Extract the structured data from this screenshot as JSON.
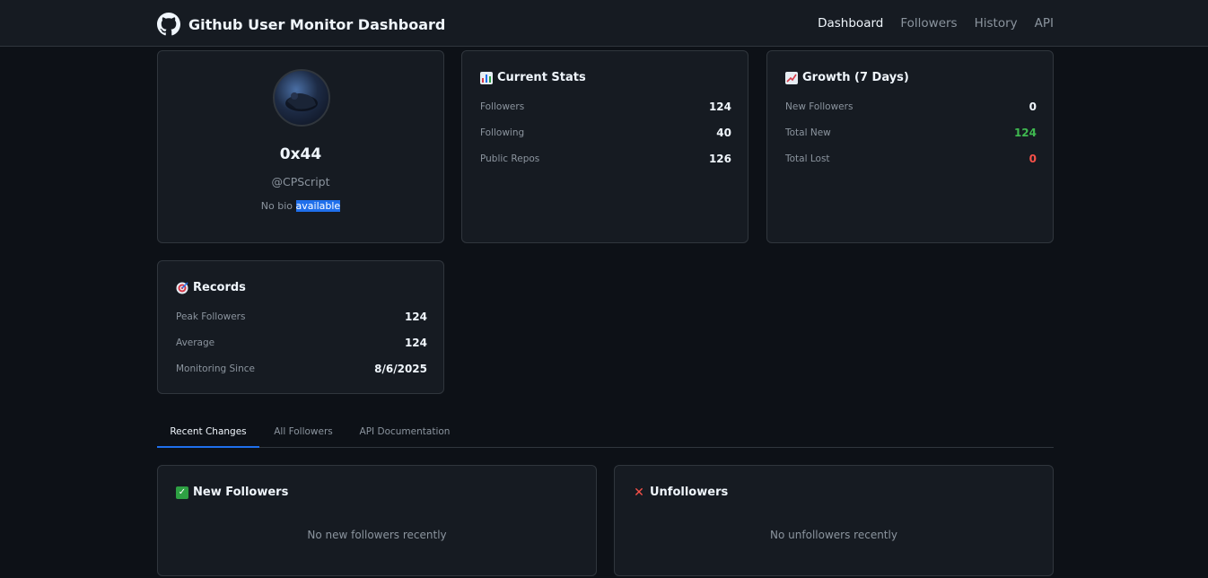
{
  "header": {
    "title": "Github User Monitor Dashboard",
    "nav": [
      "Dashboard",
      "Followers",
      "History",
      "API"
    ]
  },
  "profile": {
    "name": "0x44",
    "handle": "@CPScript",
    "bio_prefix": "No bio",
    "bio_highlighted": "available"
  },
  "current_stats": {
    "title": "Current Stats",
    "rows": [
      {
        "label": "Followers",
        "value": "124"
      },
      {
        "label": "Following",
        "value": "40"
      },
      {
        "label": "Public Repos",
        "value": "126"
      }
    ]
  },
  "growth": {
    "title": "Growth (7 Days)",
    "rows": [
      {
        "label": "New Followers",
        "value": "0"
      },
      {
        "label": "Total New",
        "value": "124"
      },
      {
        "label": "Total Lost",
        "value": "0"
      }
    ]
  },
  "records": {
    "title": "Records",
    "rows": [
      {
        "label": "Peak Followers",
        "value": "124"
      },
      {
        "label": "Average",
        "value": "124"
      },
      {
        "label": "Monitoring Since",
        "value": "8/6/2025"
      }
    ]
  },
  "tabs": [
    "Recent Changes",
    "All Followers",
    "API Documentation"
  ],
  "new_followers": {
    "title": "New Followers",
    "empty": "No new followers recently"
  },
  "unfollowers": {
    "title": "Unfollowers",
    "empty": "No unfollowers recently"
  },
  "icons": {
    "brand": "github-octocat-icon",
    "current_stats": "bar-chart-icon",
    "growth": "trending-up-icon",
    "records": "target-icon",
    "new_followers": "check-mark-icon",
    "unfollowers": "cross-mark-icon"
  },
  "colors": {
    "background": "#0d1117",
    "card": "#161b22",
    "border": "#30363d",
    "accent": "#1f6feb",
    "positive": "#3fb950",
    "negative": "#f85149"
  }
}
